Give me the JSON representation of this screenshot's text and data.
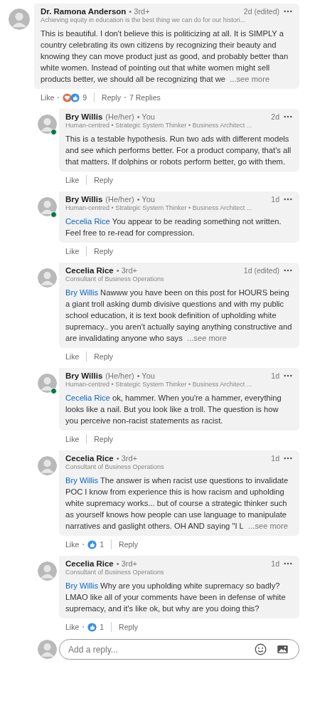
{
  "comment": {
    "author": "Dr. Ramona Anderson",
    "degree": "• 3rd+",
    "headline": "Achieving equity in education is the best thing we can do for our histori...",
    "time": "2d (edited)",
    "online": false,
    "body": "This is beautiful. I don't believe this is politicizing at all. It is SIMPLY a country celebrating its own citizens by recognizing their beauty and knowing they can move product just as good, and probably better than white women. Instead of pointing out that white women might sell products better, we should all be recognizing that we",
    "see_more": "...see more",
    "like": "Like",
    "reactions": {
      "love": true,
      "count": "9"
    },
    "reply": "Reply",
    "replies_count": "7 Replies"
  },
  "replies": [
    {
      "author": "Bry Willis",
      "pronouns": "(He/her)",
      "degree": "• You",
      "headline": "Human-centred • Strategic System Thinker • Business Architect ...",
      "time": "2d",
      "online": true,
      "body": "This is a testable hypothesis. Run two ads with different models and see which performs better. For a product company, that's all that matters. If dolphins or robots perform better, go with them.",
      "like": "Like",
      "reply": "Reply"
    },
    {
      "author": "Bry Willis",
      "pronouns": "(He/her)",
      "degree": "• You",
      "headline": "Human-centred • Strategic System Thinker • Business Architect ...",
      "time": "1d",
      "online": true,
      "mention": "Cecelia Rice",
      "body": "You appear to be reading something not written. Feel free to re-read for compression.",
      "like": "Like",
      "reply": "Reply"
    },
    {
      "author": "Cecelia Rice",
      "degree": "• 3rd+",
      "headline": "Consultant of Business Operations",
      "time": "1d (edited)",
      "online": false,
      "mention": "Bry Willis",
      "body": "Nawww you have been on this post for HOURS being a giant troll asking dumb divisive questions and with my public school education, it is text book definition of upholding white supremacy.. you aren't actually saying anything constructive and are invalidating anyone who says",
      "see_more": "...see more",
      "like": "Like",
      "reply": "Reply"
    },
    {
      "author": "Bry Willis",
      "pronouns": "(He/her)",
      "degree": "• You",
      "headline": "Human-centred • Strategic System Thinker • Business Architect ...",
      "time": "1d",
      "online": true,
      "mention": "Cecelia Rice",
      "body": "ok, hammer. When you're a hammer, everything looks like a nail. But you look like a troll. The question is how you perceive non-racist statements as racist.",
      "like": "Like",
      "reply": "Reply"
    },
    {
      "author": "Cecelia Rice",
      "degree": "• 3rd+",
      "headline": "Consultant of Business Operations",
      "time": "1d",
      "online": false,
      "mention": "Bry Willis",
      "body": "The answer is when racist use questions to invalidate POC I know from experience this is how racism and upholding white supremacy works... but of course a strategic thinker such as yourself knows how people can use language to manipulate narratives and gaslight others. OH AND saying \"I L",
      "see_more": "...see more",
      "like": "Like",
      "reactions": {
        "love": false,
        "count": "1"
      },
      "reply": "Reply"
    },
    {
      "author": "Cecelia Rice",
      "degree": "• 3rd+",
      "headline": "Consultant of Business Operations",
      "time": "1d",
      "online": false,
      "mention": "Bry Willis",
      "body": "Why are you upholding white supremacy so badly? LMAO like all of your comments have been in defense of white supremacy, and it's like ok, but why are you doing this?",
      "like": "Like",
      "reactions": {
        "love": false,
        "count": "1"
      },
      "reply": "Reply"
    }
  ],
  "composer": {
    "placeholder": "Add a reply..."
  }
}
